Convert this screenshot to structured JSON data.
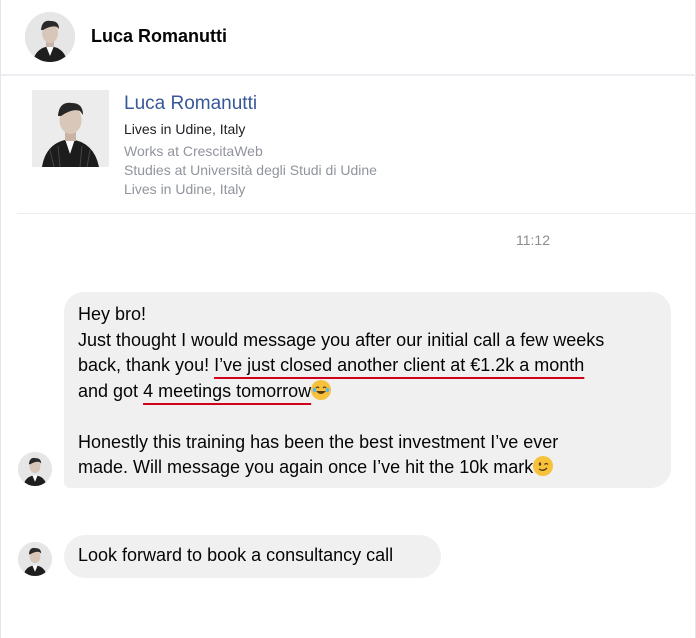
{
  "header": {
    "contact_name": "Luca Romanutti"
  },
  "profile": {
    "name": "Luca Romanutti",
    "lives": "Lives in Udine, Italy",
    "works": "Works at CrescitaWeb",
    "studies": "Studies at Università degli Studi di Udine",
    "lives_again": "Lives in Udine, Italy"
  },
  "timestamp": "11:12",
  "messages": [
    {
      "line1": "Hey bro!",
      "line2": "Just thought I would message you after our initial call a few weeks",
      "line3_a": "back, thank you! ",
      "line3_b": "I’ve just closed another client at €1.2k a month",
      "line4_a": "and got ",
      "line4_b": "4 meetings tomorrow",
      "line4_emoji": "laughing-tears-emoji",
      "line5": "Honestly this training has been the best investment I’ve ever",
      "line6": "made. Will message you again once I’ve hit the 10k mark",
      "line6_emoji": "winking-emoji"
    },
    {
      "text": "Look forward to book a consultancy call"
    }
  ],
  "colors": {
    "underline": "#d0021b",
    "link": "#385898",
    "bubble": "#f0f0f0"
  }
}
